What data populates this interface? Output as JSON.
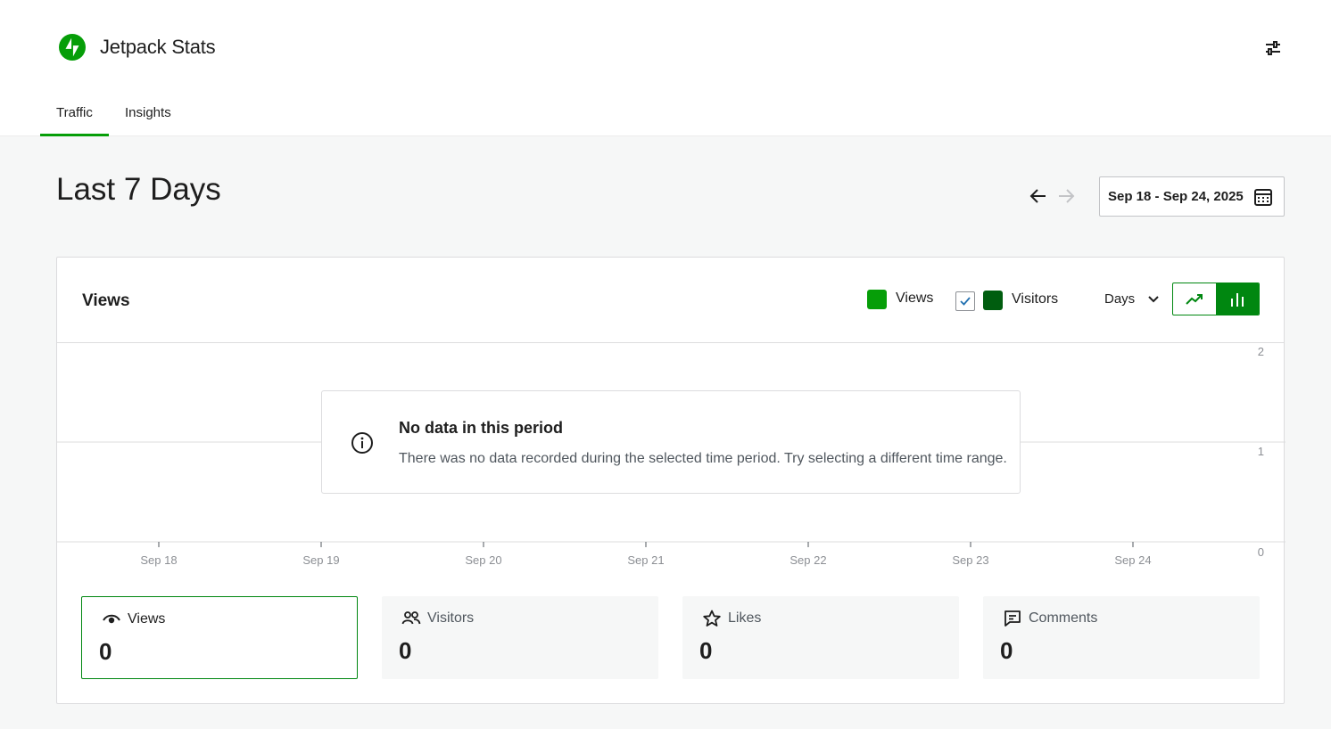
{
  "app": {
    "title": "Jetpack Stats",
    "logo_icon": "jetpack-logo-icon",
    "brand_color": "#069e08"
  },
  "tabs": [
    {
      "label": "Traffic",
      "active": true
    },
    {
      "label": "Insights",
      "active": false
    }
  ],
  "page": {
    "title": "Last 7 Days"
  },
  "date_range": {
    "label": "Sep 18 - Sep 24, 2025"
  },
  "chart": {
    "title": "Views",
    "legend": [
      {
        "label": "Views",
        "color": "#069e08"
      },
      {
        "label": "Visitors",
        "color": "#005d0f",
        "checked": true
      }
    ],
    "period": "Days",
    "view_modes": [
      "line-chart-icon",
      "bar-chart-icon"
    ],
    "active_view": "bar-chart-icon",
    "empty": {
      "title": "No data in this period",
      "description": "There was no data recorded during the selected time period. Try selecting a different time range."
    }
  },
  "chart_data": {
    "type": "bar",
    "categories": [
      "Sep 18",
      "Sep 19",
      "Sep 20",
      "Sep 21",
      "Sep 22",
      "Sep 23",
      "Sep 24"
    ],
    "series": [
      {
        "name": "Views",
        "values": [
          0,
          0,
          0,
          0,
          0,
          0,
          0
        ]
      },
      {
        "name": "Visitors",
        "values": [
          0,
          0,
          0,
          0,
          0,
          0,
          0
        ]
      }
    ],
    "yticks": [
      "0",
      "1",
      "2"
    ],
    "ylim": [
      0,
      2
    ],
    "grid": true
  },
  "stats": [
    {
      "label": "Views",
      "value": "0",
      "icon": "eye-icon",
      "selected": true
    },
    {
      "label": "Visitors",
      "value": "0",
      "icon": "people-icon",
      "selected": false
    },
    {
      "label": "Likes",
      "value": "0",
      "icon": "star-icon",
      "selected": false
    },
    {
      "label": "Comments",
      "value": "0",
      "icon": "comment-icon",
      "selected": false
    }
  ]
}
